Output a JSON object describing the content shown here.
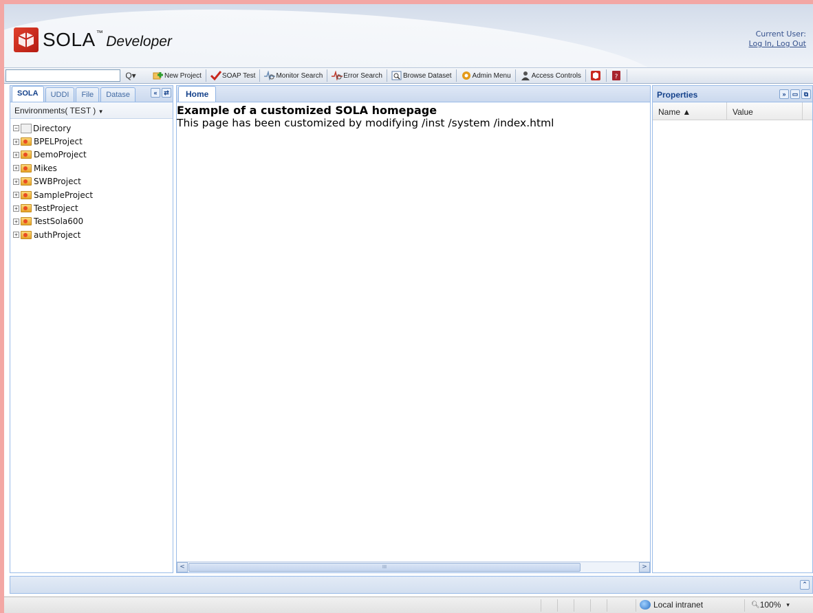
{
  "header": {
    "logo_text": "SOLA",
    "logo_tm": "™",
    "logo_sub": "Developer",
    "current_user_label": "Current User:",
    "login_logout": "Log In, Log Out"
  },
  "toolbar": {
    "search_value": "",
    "search_button": "Q▾",
    "buttons": [
      {
        "label": "New Project",
        "icon": "new-project-icon",
        "color": "#2e9c2e"
      },
      {
        "label": "SOAP Test",
        "icon": "check-icon",
        "color": "#c8281e"
      },
      {
        "label": "Monitor Search",
        "icon": "monitor-search-icon",
        "color": "#6b8db5"
      },
      {
        "label": "Error Search",
        "icon": "error-search-icon",
        "color": "#c0392b"
      },
      {
        "label": "Browse Dataset",
        "icon": "browse-dataset-icon",
        "color": "#5d7ea8"
      },
      {
        "label": "Admin Menu",
        "icon": "admin-gear-icon",
        "color": "#e49a1a"
      },
      {
        "label": "Access Controls",
        "icon": "access-user-icon",
        "color": "#444444"
      }
    ]
  },
  "left_panel": {
    "tabs": [
      "SOLA",
      "UDDI",
      "File",
      "Datase"
    ],
    "environment": "Environments( TEST )",
    "tree_root": "Directory",
    "projects": [
      "BPELProject",
      "DemoProject",
      "Mikes",
      "SWBProject",
      "SampleProject",
      "TestProject",
      "TestSola600",
      "authProject"
    ]
  },
  "center_panel": {
    "tab": "Home",
    "heading": "Example of a customized SOLA homepage",
    "text": "This page has been customized by modifying /inst /system /index.html",
    "scroll_left": "<",
    "scroll_right": ">",
    "scroll_thumb": "III"
  },
  "right_panel": {
    "title": "Properties",
    "col_name": "Name ▲",
    "col_value": "Value"
  },
  "statusbar": {
    "zone": "Local intranet",
    "zoom": "100%",
    "zoom_caret": "▾"
  },
  "colors": {
    "accent": "#15428b",
    "panel_border": "#99bbe8",
    "frame": "#f3a7a4"
  }
}
